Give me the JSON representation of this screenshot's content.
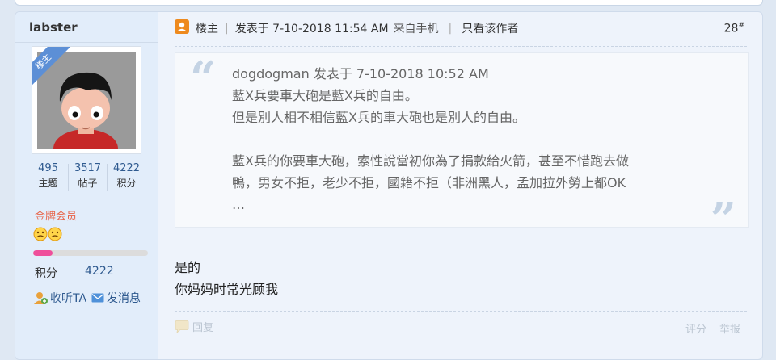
{
  "user": {
    "name": "labster",
    "badge": "楼主",
    "stats": [
      {
        "num": "495",
        "label": "主题"
      },
      {
        "num": "3517",
        "label": "帖子"
      },
      {
        "num": "4222",
        "label": "积分"
      }
    ],
    "level": "金牌会员",
    "level_progress": 0.17,
    "score_label": "积分",
    "score_value": "4222",
    "follow_label": "收听TA",
    "message_label": "发消息"
  },
  "post": {
    "author_tag": "楼主",
    "posted_label": "发表于 7-10-2018 11:54 AM",
    "source": "来自手机",
    "only_author": "只看该作者",
    "floor": "28",
    "floor_sup": "#",
    "quote": {
      "header": "dogdogman 发表于 7-10-2018 10:52 AM",
      "line1": "藍X兵要車大砲是藍X兵的自由。",
      "line2": "但是別人相不相信藍X兵的車大砲也是別人的自由。",
      "line3": "藍X兵的你要車大砲，索性說當初你為了捐款給火箭，甚至不惜跑去做",
      "line4": "鴨，男女不拒，老少不拒，國籍不拒（非洲黑人，孟加拉外勞上都OK",
      "line5": "…"
    },
    "reply_line1": "是的",
    "reply_line2": "你妈妈时常光顾我"
  },
  "footer": {
    "reply": "回复",
    "rate": "评分",
    "report": "举报"
  }
}
